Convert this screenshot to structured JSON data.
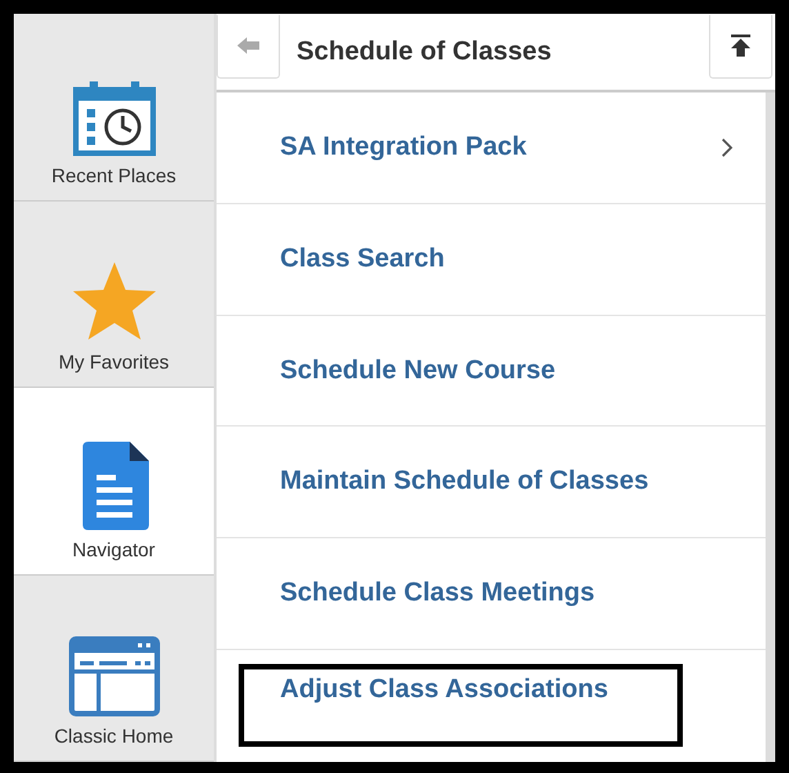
{
  "sidebar": {
    "items": [
      {
        "label": "Recent Places",
        "kind": "calendar",
        "selected": false
      },
      {
        "label": "My Favorites",
        "kind": "star",
        "selected": false
      },
      {
        "label": "Navigator",
        "kind": "document",
        "selected": true
      },
      {
        "label": "Classic Home",
        "kind": "window",
        "selected": false
      }
    ]
  },
  "header": {
    "title": "Schedule of Classes"
  },
  "menu": {
    "items": [
      {
        "label": "SA Integration Pack",
        "has_children": true,
        "highlighted": false
      },
      {
        "label": "Class Search",
        "has_children": false,
        "highlighted": false
      },
      {
        "label": "Schedule New Course",
        "has_children": false,
        "highlighted": false
      },
      {
        "label": "Maintain Schedule of Classes",
        "has_children": false,
        "highlighted": false
      },
      {
        "label": "Schedule Class Meetings",
        "has_children": false,
        "highlighted": false
      },
      {
        "label": "Adjust Class Associations",
        "has_children": false,
        "highlighted": true
      }
    ]
  }
}
